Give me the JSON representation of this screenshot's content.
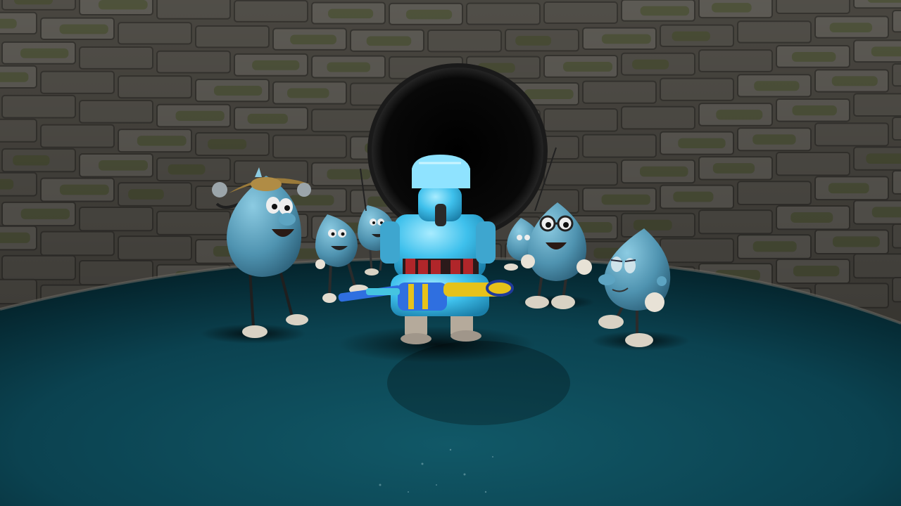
{
  "scene": {
    "description_visible_text": "",
    "palette": {
      "brick": "#6d6a63",
      "brick_dark": "#3f3d38",
      "mortar": "#8d8a82",
      "moss": "#4e5a2e",
      "floor": "#0c4552",
      "floor_dark": "#052a33",
      "tunnel": "#050505",
      "droplet": "#4f93b0",
      "droplet_light": "#7cc0db",
      "robot": "#38b9e8",
      "robot_light": "#8fe3ff",
      "belt": "#b0262a",
      "gun_yellow": "#e6c21a",
      "gun_blue": "#2f6fe0",
      "hat": "#9a7a3a",
      "shoe": "#d9d2c4"
    },
    "characters": [
      {
        "id": "droplet-with-hat",
        "kind": "droplet",
        "accessory": "hat-icon"
      },
      {
        "id": "droplet-small-left",
        "kind": "droplet"
      },
      {
        "id": "droplet-back-left",
        "kind": "droplet"
      },
      {
        "id": "robot-hero",
        "kind": "robot",
        "accessory": "water-gun-icon"
      },
      {
        "id": "droplet-back-right",
        "kind": "droplet"
      },
      {
        "id": "droplet-with-glasses",
        "kind": "droplet",
        "accessory": "glasses-icon"
      },
      {
        "id": "droplet-front-right",
        "kind": "droplet"
      }
    ]
  }
}
